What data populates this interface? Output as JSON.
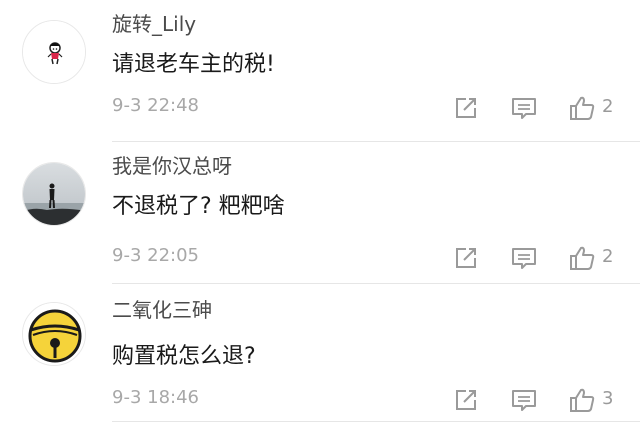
{
  "comments": [
    {
      "username": "旋转_Lily",
      "text": "请退老车主的税!",
      "time": "9-3 22:48",
      "likes": "2",
      "avatar": "cartoon-figure-avatar"
    },
    {
      "username": "我是你汉总呀",
      "text": "不退税了? 粑粑啥",
      "time": "9-3 22:05",
      "likes": "2",
      "avatar": "seaside-photo-avatar"
    },
    {
      "username": "二氧化三砷",
      "text": "购置税怎么退?",
      "time": "9-3 18:46",
      "likes": "3",
      "avatar": "yellow-bell-avatar"
    }
  ],
  "icons": {
    "share": "share-icon",
    "reply": "reply-icon",
    "like": "thumbs-up-icon"
  },
  "colors": {
    "accent_yellow": "#f5d33a",
    "icon_gray": "#9a9a9a"
  }
}
